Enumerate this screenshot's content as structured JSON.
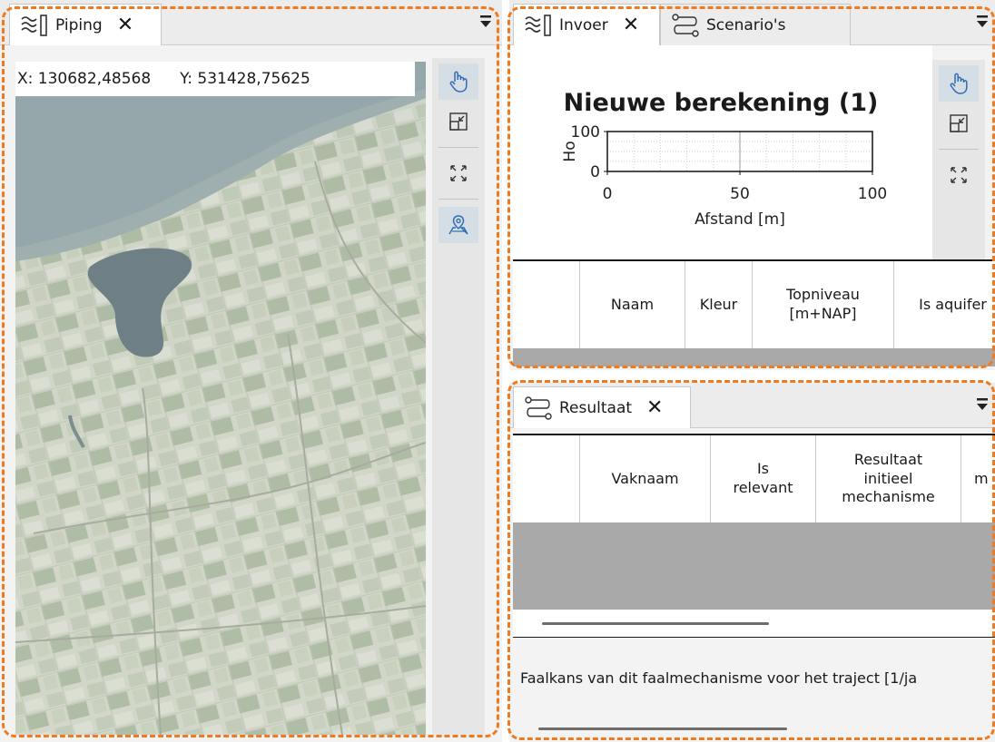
{
  "map_panel": {
    "tab_label": "Piping",
    "close_glyph": "✕",
    "coord_x": "X: 130682,48568",
    "coord_y": "Y: 531428,75625",
    "tools": [
      "pan-hand-icon",
      "zoom-to-extent-icon",
      "zoom-to-all-icon",
      "map-layer-icon"
    ]
  },
  "input_panel": {
    "tabs": [
      {
        "label": "Invoer",
        "icon": "waves-icon",
        "close_glyph": "✕"
      },
      {
        "label": "Scenario's",
        "icon": "scenario-icon"
      }
    ],
    "chart_tools": [
      "pan-hand-icon",
      "zoom-to-extent-icon",
      "zoom-to-all-icon"
    ],
    "grid_columns": [
      "",
      "Naam",
      "Kleur",
      "Topniveau\n[m+NAP]",
      "Is aquifer"
    ]
  },
  "result_panel": {
    "tab_label": "Resultaat",
    "close_glyph": "✕",
    "grid_columns": [
      "",
      "Vaknaam",
      "Is\nrelevant",
      "Resultaat\ninitieel\nmechanisme",
      "m"
    ],
    "footer_text": "Faalkans van dit faalmechanisme voor het traject [1/ja"
  },
  "chart_data": {
    "type": "line",
    "title": "Nieuwe berekening (1)",
    "xlabel": "Afstand [m]",
    "ylabel": "Ho",
    "xlim": [
      0,
      100
    ],
    "ylim": [
      0,
      100
    ],
    "xticks": [
      0,
      50,
      100
    ],
    "yticks": [
      0,
      100
    ],
    "grid": true,
    "series": []
  },
  "colors": {
    "accent_border": "#f07a1d",
    "grid_body": "#a9a9a9",
    "tool_active": "#d5dde5",
    "icon_blue": "#2f6db5"
  }
}
